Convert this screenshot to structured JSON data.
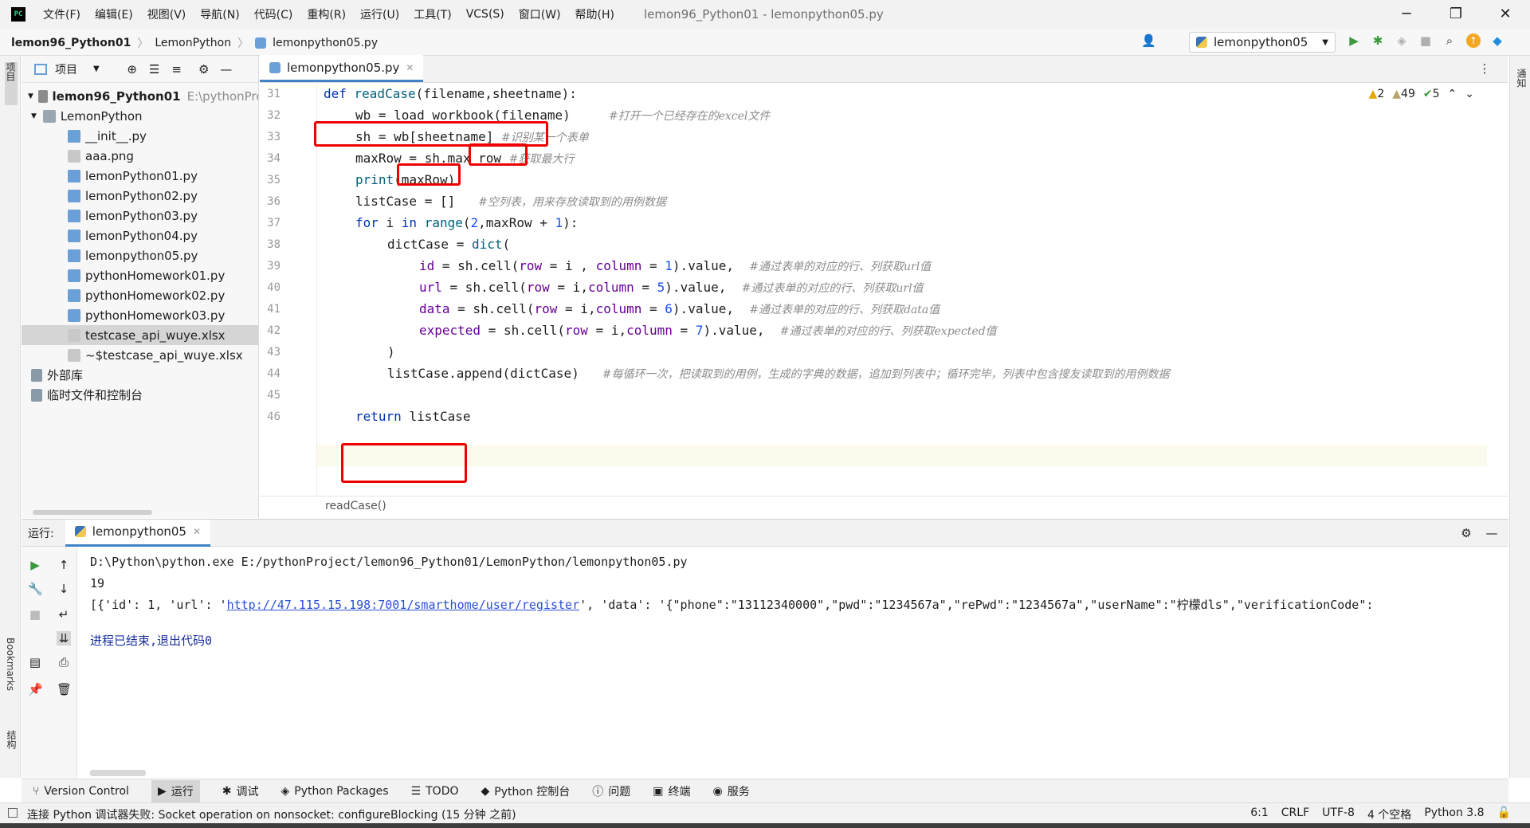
{
  "menubar": {
    "items": [
      "文件(F)",
      "编辑(E)",
      "视图(V)",
      "导航(N)",
      "代码(C)",
      "重构(R)",
      "运行(U)",
      "工具(T)",
      "VCS(S)",
      "窗口(W)",
      "帮助(H)"
    ],
    "window_title": "lemon96_Python01 - lemonpython05.py"
  },
  "navbar": {
    "crumbs": [
      "lemon96_Python01",
      "LemonPython",
      "lemonpython05.py"
    ],
    "run_config": "lemonpython05"
  },
  "left_strip": {
    "project_tab": "项目",
    "bookmarks_tab": "Bookmarks",
    "structure_tab": "结构"
  },
  "right_strip": {
    "notifications_tab": "通知"
  },
  "project": {
    "header": "项目",
    "root_name": "lemon96_Python01",
    "root_path": "E:\\pythonProject",
    "folder": "LemonPython",
    "files": [
      "__init__.py",
      "aaa.png",
      "lemonPython01.py",
      "lemonPython02.py",
      "lemonPython03.py",
      "lemonPython04.py",
      "lemonpython05.py",
      "pythonHomework01.py",
      "pythonHomework02.py",
      "pythonHomework03.py",
      "testcase_api_wuye.xlsx",
      "~$testcase_api_wuye.xlsx"
    ],
    "external_libs": "外部库",
    "scratches": "临时文件和控制台"
  },
  "editor": {
    "tab_label": "lemonpython05.py",
    "line_numbers": [
      "31",
      "32",
      "33",
      "34",
      "35",
      "36",
      "37",
      "38",
      "39",
      "40",
      "41",
      "42",
      "43",
      "44",
      "45",
      "46"
    ],
    "inspections": {
      "warn": "2",
      "weak": "49",
      "ok": "5"
    },
    "breadcrumb": "readCase()",
    "comments": {
      "c32": "#打开一个已经存在的excel文件",
      "c33": "#识别某一个表单",
      "c34": "#获取最大行",
      "c36": "#空列表，用来存放读取到的用例数据",
      "c39": "#通过表单的对应的行、列获取url值",
      "c40": "#通过表单的对应的行、列获取url值",
      "c41": "#通过表单的对应的行、列获取data值",
      "c42": "#通过表单的对应的行、列获取expected值",
      "c44": "#每循环一次，把读取到的用例，生成的字典的数据，追加到列表中；循环完毕，列表中包含搜友读取到的用例数据"
    }
  },
  "run": {
    "label": "运行:",
    "tab_label": "lemonpython05",
    "console": {
      "cmd": "D:\\Python\\python.exe E:/pythonProject/lemon96_Python01/LemonPython/lemonpython05.py",
      "out1": "19",
      "out2_pre": "[{'id': 1, 'url': '",
      "out2_link": "http://47.115.15.198:7001/smarthome/user/register",
      "out2_post": "', 'data': '{\"phone\":\"13112340000\",\"pwd\":\"1234567a\",\"rePwd\":\"1234567a\",\"userName\":\"柠檬dls\",\"verificationCode\":",
      "exit": "进程已结束,退出代码0"
    }
  },
  "bottom_tabs": [
    "Version Control",
    "运行",
    "调试",
    "Python Packages",
    "TODO",
    "Python 控制台",
    "问题",
    "终端",
    "服务"
  ],
  "status": {
    "message": "连接 Python 调试器失败: Socket operation on nonsocket: configureBlocking (15 分钟 之前)",
    "position": "6:1",
    "line_sep": "CRLF",
    "encoding": "UTF-8",
    "indent": "4 个空格",
    "interpreter": "Python 3.8"
  }
}
